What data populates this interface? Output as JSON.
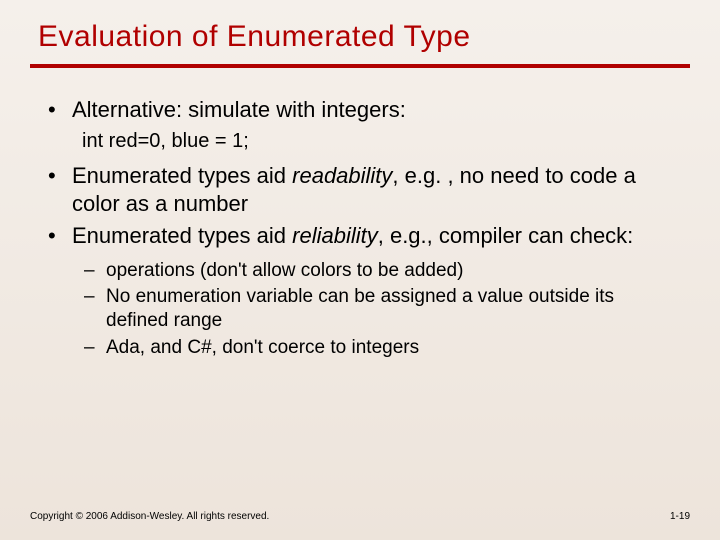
{
  "title": "Evaluation of Enumerated Type",
  "bullets": {
    "b1": "Alternative: simulate with integers:",
    "b1_sub": "int red=0, blue = 1;",
    "b2_pre": "Enumerated types aid ",
    "b2_em": "readability",
    "b2_post": ", e.g. , no need to code a color as a number",
    "b3_pre": "Enumerated types aid ",
    "b3_em": "reliability",
    "b3_post": ", e.g., compiler can check:"
  },
  "dashes": {
    "d1": "operations (don't allow colors to be added)",
    "d2": "No enumeration variable can be assigned a value outside its defined range",
    "d3": "Ada, and C#, don't coerce to integers"
  },
  "footer": {
    "copyright": "Copyright © 2006 Addison-Wesley. All rights reserved.",
    "page": "1-19"
  }
}
